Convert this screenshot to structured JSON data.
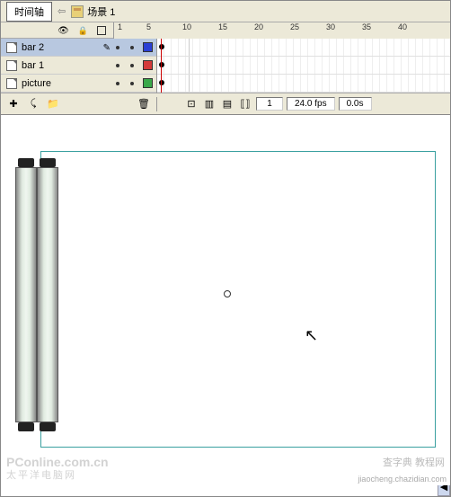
{
  "topbar": {
    "timeline_tab": "时间轴",
    "scene_label": "场景 1"
  },
  "ruler_ticks": [
    1,
    5,
    10,
    15,
    20,
    25,
    30,
    35,
    40
  ],
  "layers": [
    {
      "name": "bar 2",
      "selected": true,
      "color": "#2a3fd4"
    },
    {
      "name": "bar 1",
      "selected": false,
      "color": "#d43a3a"
    },
    {
      "name": "picture",
      "selected": false,
      "color": "#3aa84a"
    }
  ],
  "status": {
    "current_frame": "1",
    "fps": "24.0 fps",
    "time": "0.0s"
  },
  "watermarks": {
    "w1": "PConline.com.cn",
    "w2": "太平洋电脑网",
    "w3": "查字典  教程网",
    "w4": "jiaocheng.chazidian.com"
  }
}
